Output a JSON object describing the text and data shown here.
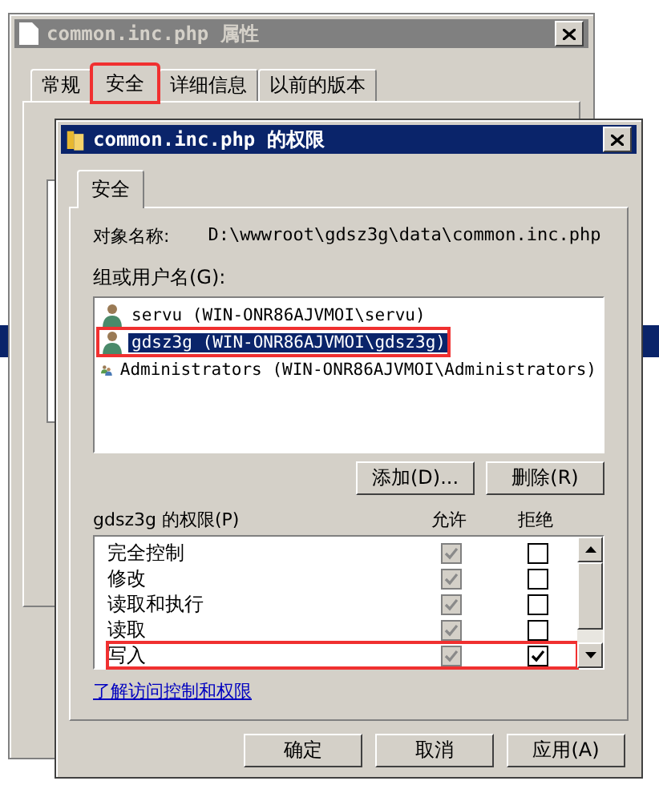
{
  "background_window": {
    "title": "common.inc.php 属性",
    "tabs": [
      {
        "label": "常规",
        "selected": false,
        "highlighted": false
      },
      {
        "label": "安全",
        "selected": true,
        "highlighted": true
      },
      {
        "label": "详细信息",
        "selected": false,
        "highlighted": false
      },
      {
        "label": "以前的版本",
        "selected": false,
        "highlighted": false
      }
    ]
  },
  "dialog": {
    "title": "common.inc.php 的权限",
    "tabs": [
      {
        "label": "安全",
        "selected": true
      }
    ],
    "object_name_label": "对象名称:",
    "object_name": "D:\\wwwroot\\gdsz3g\\data\\common.inc.php",
    "group_label": "组或用户名(G):",
    "users": [
      {
        "name": "servu (WIN-ONR86AJVMOI\\servu)",
        "kind": "user",
        "selected": false,
        "highlighted": false
      },
      {
        "name": "gdsz3g (WIN-ONR86AJVMOI\\gdsz3g)",
        "kind": "user",
        "selected": true,
        "highlighted": true
      },
      {
        "name": "Administrators (WIN-ONR86AJVMOI\\Administrators)",
        "kind": "group",
        "selected": false,
        "highlighted": false
      }
    ],
    "add_button": "添加(D)...",
    "remove_button": "删除(R)",
    "permissions_label": "gdsz3g 的权限(P)",
    "allow_header": "允许",
    "deny_header": "拒绝",
    "permissions": [
      {
        "name": "完全控制",
        "allow": true,
        "allow_inherited": true,
        "deny": false,
        "highlighted": false
      },
      {
        "name": "修改",
        "allow": true,
        "allow_inherited": true,
        "deny": false,
        "highlighted": false
      },
      {
        "name": "读取和执行",
        "allow": true,
        "allow_inherited": true,
        "deny": false,
        "highlighted": false
      },
      {
        "name": "读取",
        "allow": true,
        "allow_inherited": true,
        "deny": false,
        "highlighted": false
      },
      {
        "name": "写入",
        "allow": true,
        "allow_inherited": true,
        "deny": true,
        "highlighted": true
      }
    ],
    "link": "了解访问控制和权限",
    "buttons": [
      "确定",
      "取消",
      "应用(A)"
    ]
  }
}
